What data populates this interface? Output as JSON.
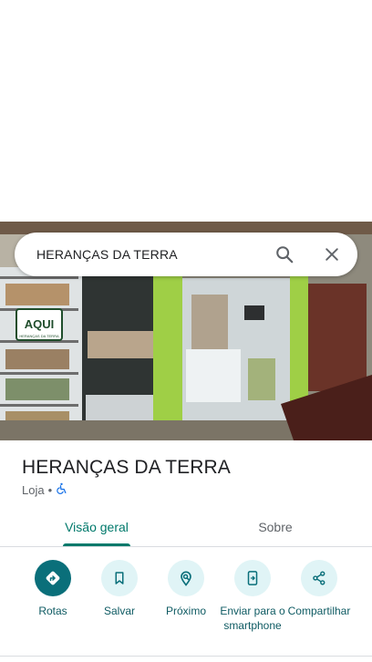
{
  "search": {
    "query": "HERANÇAS DA TERRA",
    "search_icon": "search-icon",
    "close_icon": "close-icon"
  },
  "photo": {
    "storefront_sign": "AQUI",
    "storefront_sign_sub": "HERANÇAS DA TERRA"
  },
  "place": {
    "name": "HERANÇAS DA TERRA",
    "category": "Loja",
    "separator": "•",
    "accessibility_icon": "wheelchair-icon"
  },
  "tabs": [
    {
      "label": "Visão geral",
      "active": true
    },
    {
      "label": "Sobre",
      "active": false
    }
  ],
  "actions": [
    {
      "label": "Rotas",
      "icon": "directions-icon",
      "primary": true
    },
    {
      "label": "Salvar",
      "icon": "bookmark-icon",
      "primary": false
    },
    {
      "label": "Próximo",
      "icon": "nearby-icon",
      "primary": false
    },
    {
      "label": "Enviar para o smartphone",
      "icon": "send-to-phone-icon",
      "primary": false
    },
    {
      "label": "Compartilhar",
      "icon": "share-icon",
      "primary": false
    }
  ],
  "colors": {
    "accent": "#00796b",
    "primary_button": "#0a6f7a",
    "action_bg": "#e0f4f6",
    "action_text": "#0f5b63"
  }
}
